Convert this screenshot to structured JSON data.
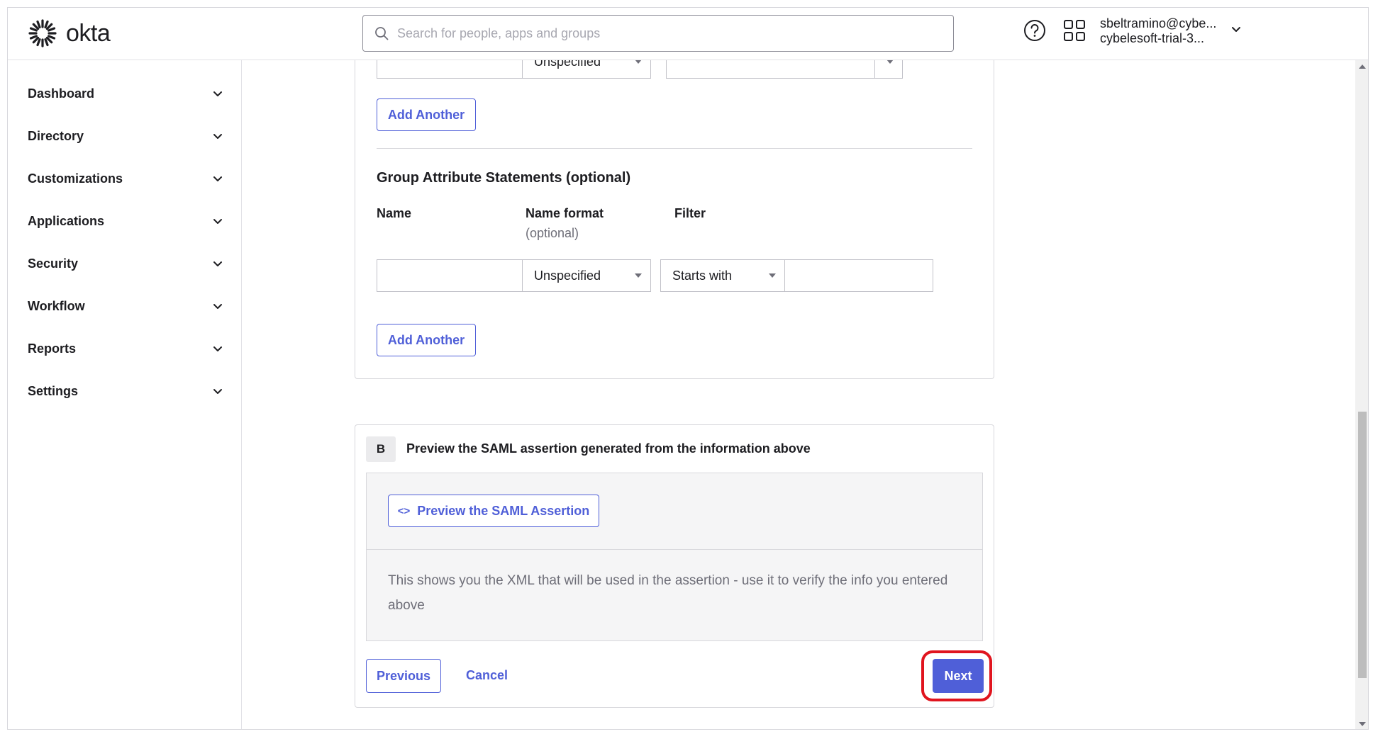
{
  "header": {
    "logo_text": "okta",
    "search_placeholder": "Search for people, apps and groups",
    "user_email": "sbeltramino@cybe...",
    "user_org": "cybelesoft-trial-3..."
  },
  "sidebar": {
    "items": [
      {
        "label": "Dashboard"
      },
      {
        "label": "Directory"
      },
      {
        "label": "Customizations"
      },
      {
        "label": "Applications"
      },
      {
        "label": "Security"
      },
      {
        "label": "Workflow"
      },
      {
        "label": "Reports"
      },
      {
        "label": "Settings"
      }
    ]
  },
  "attribute_statements": {
    "name_format_value": "Unspecified",
    "add_another_label": "Add Another"
  },
  "group_attributes": {
    "title": "Group Attribute Statements (optional)",
    "col_name": "Name",
    "col_name_format": "Name format",
    "col_name_format_sub": "(optional)",
    "col_filter": "Filter",
    "name_format_value": "Unspecified",
    "filter_value": "Starts with",
    "add_another_label": "Add Another"
  },
  "section_b": {
    "badge": "B",
    "title": "Preview the SAML assertion generated from the information above",
    "preview_button": "Preview the SAML Assertion",
    "preview_icon": "<>",
    "help_text": "This shows you the XML that will be used in the assertion - use it to verify the info you entered above"
  },
  "footer": {
    "previous_label": "Previous",
    "cancel_label": "Cancel",
    "next_label": "Next"
  },
  "colors": {
    "primary": "#4f5fd8",
    "highlight": "#e0141e"
  }
}
